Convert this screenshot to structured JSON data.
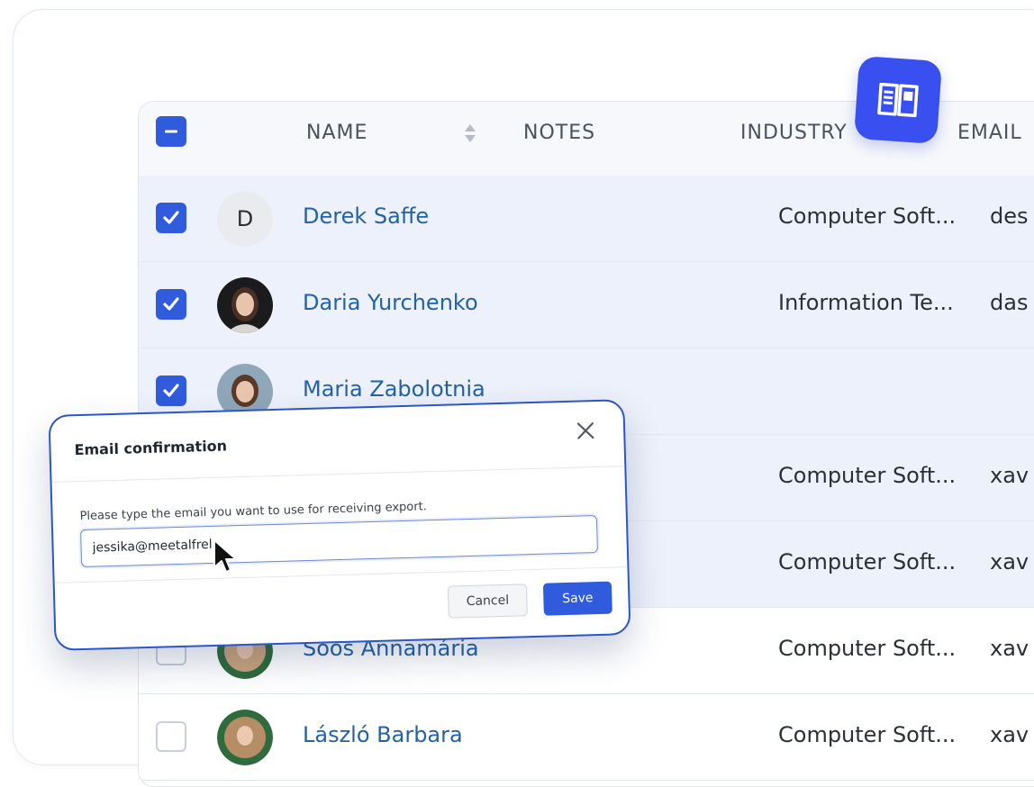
{
  "table": {
    "columns": {
      "name": "NAME",
      "notes": "NOTES",
      "industry": "INDUSTRY",
      "email": "EMAIL"
    },
    "rows": [
      {
        "name": "Derek Saffe",
        "avatar_letter": "D",
        "industry": "Computer Soft...",
        "email": "des",
        "selected": true
      },
      {
        "name": "Daria Yurchenko",
        "industry": "Information Te...",
        "email": "das",
        "selected": true
      },
      {
        "name": "Maria Zabolotnia",
        "industry": "",
        "email": "",
        "selected": true
      },
      {
        "name": "",
        "industry": "Computer Soft...",
        "email": "xav",
        "selected": true
      },
      {
        "name": "",
        "industry": "Computer Soft...",
        "email": "xav",
        "selected": true
      },
      {
        "name": "Soos Annamária",
        "industry": "Computer Soft...",
        "email": "xav",
        "selected": false
      },
      {
        "name": "László Barbara",
        "industry": "Computer Soft...",
        "email": "xav",
        "selected": false
      }
    ]
  },
  "modal": {
    "title": "Email confirmation",
    "label": "Please type the email you want to use for receiving export.",
    "input_value": "jessika@meetalfrel",
    "cancel_label": "Cancel",
    "save_label": "Save"
  },
  "colors": {
    "accent": "#2f5bdc",
    "selected_row": "#edf1fb",
    "link": "#2361a8",
    "badge": "#3a4ff0"
  },
  "icons": {
    "badge": "open-book-icon",
    "close": "close-icon",
    "sort": "sort-icon",
    "cursor": "mouse-pointer-icon"
  }
}
